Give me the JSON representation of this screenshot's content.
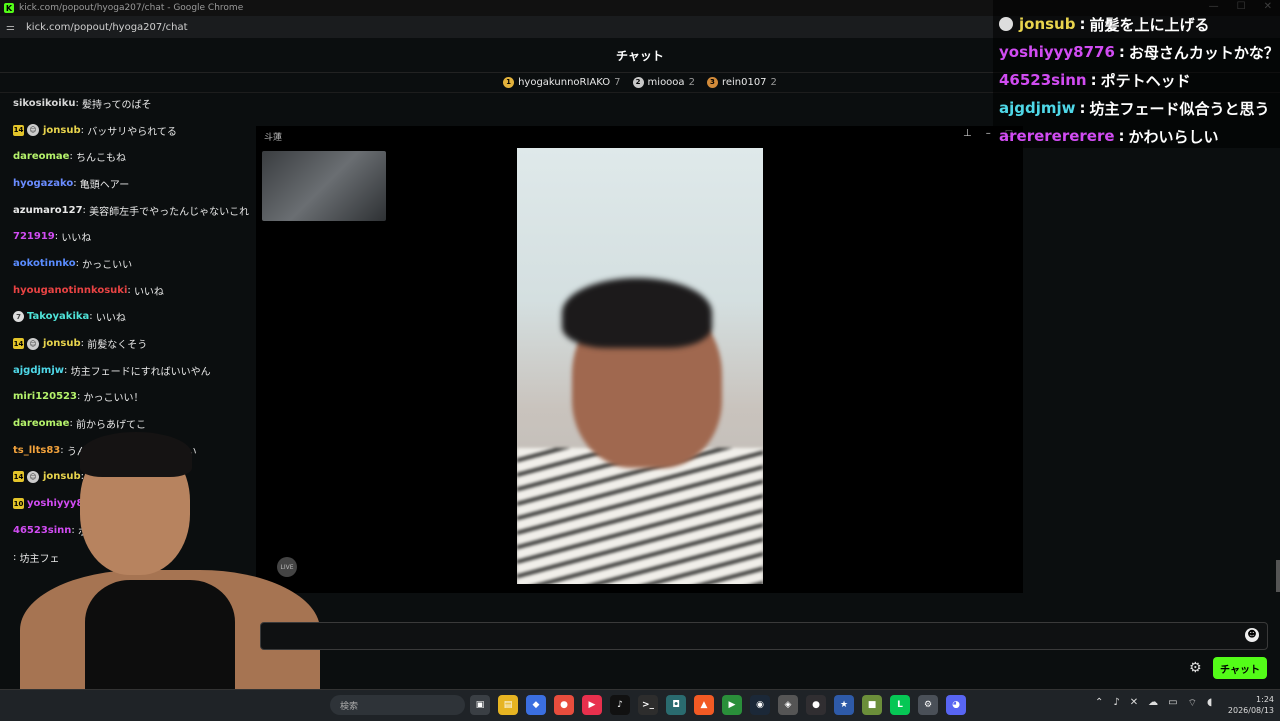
{
  "window": {
    "title": "kick.com/popout/hyoga207/chat - Google Chrome",
    "url": "kick.com/popout/hyoga207/chat"
  },
  "header": {
    "title": "チャット"
  },
  "leaderboard": [
    {
      "rank": "1",
      "name": "hyogakunnoRIAKO",
      "count": "7",
      "color": "#e3b23c"
    },
    {
      "rank": "2",
      "name": "mioooa",
      "count": "2",
      "color": "#c8c8c8"
    },
    {
      "rank": "3",
      "name": "rein0107",
      "count": "2",
      "color": "#d28b3a"
    }
  ],
  "messages": [
    {
      "user": "sikosikoiku",
      "text": "髪持ってのばそ",
      "color": "#d6d6d6",
      "badge": "",
      "avatar": false
    },
    {
      "user": "jonsub",
      "text": "バッサリやられてる",
      "color": "#e8d44d",
      "badge": "14",
      "avatar": true
    },
    {
      "user": "dareomae",
      "text": "ちんこもね",
      "color": "#b5f26b",
      "badge": "",
      "avatar": false
    },
    {
      "user": "hyogazako",
      "text": "亀頭ヘアー",
      "color": "#6a8cff",
      "badge": "",
      "avatar": false
    },
    {
      "user": "azumaro127",
      "text": "美容師左手でやったんじゃないこれ",
      "color": "#e8e8e8",
      "badge": "",
      "avatar": false
    },
    {
      "user": "721919",
      "text": "いいね",
      "color": "#d14cf2",
      "badge": "",
      "avatar": false
    },
    {
      "user": "aokotinnko",
      "text": "かっこいい",
      "color": "#5a8cff",
      "badge": "",
      "avatar": false
    },
    {
      "user": "hyouganotinnkosuki",
      "text": "いいね",
      "color": "#e84343",
      "badge": "",
      "avatar": false
    },
    {
      "user": "Takoyakika",
      "text": "いいね",
      "color": "#4fe3d8",
      "badge": "7",
      "avatar": false
    },
    {
      "user": "jonsub",
      "text": "前髪なくそう",
      "color": "#e8d44d",
      "badge": "14",
      "avatar": true
    },
    {
      "user": "ajgdjmjw",
      "text": "坊主フェードにすればいいやん",
      "color": "#4fd8e8",
      "badge": "",
      "avatar": false
    },
    {
      "user": "miri120523",
      "text": "かっこいい！",
      "color": "#b5f26b",
      "badge": "",
      "avatar": false
    },
    {
      "user": "dareomae",
      "text": "前からあげてこ",
      "color": "#b5f26b",
      "badge": "",
      "avatar": false
    },
    {
      "user": "ts_llts83",
      "text": "うん伸ばすより短い方がいい",
      "color": "#f2a23c",
      "badge": "",
      "avatar": false
    },
    {
      "user": "jonsub",
      "text": "",
      "color": "#e8d44d",
      "badge": "14",
      "avatar": true
    },
    {
      "user": "yoshiyyy8776",
      "text": "？",
      "color": "#d14cf2",
      "badge": "10",
      "avatar": false
    },
    {
      "user": "46523sinn",
      "text": "ポ",
      "color": "#d14cf2",
      "badge": "",
      "avatar": false
    },
    {
      "user": "",
      "text": "坊主フェ",
      "color": "#4fd8e8",
      "badge": "",
      "avatar": false
    }
  ],
  "video": {
    "window_title": "斗蓮",
    "live_label": "LIVE"
  },
  "overlay": [
    {
      "user": "jonsub",
      "text": "前髪を上に上げる",
      "color": "#e8d44d",
      "avatar": true
    },
    {
      "user": "yoshiyyy8776",
      "text": "お母さんカットかな？",
      "color": "#d14cf2",
      "avatar": false
    },
    {
      "user": "46523sinn",
      "text": "ポテトヘッド",
      "color": "#d14cf2",
      "avatar": false
    },
    {
      "user": "ajgdjmjw",
      "text": "坊主フェード似合うと思う",
      "color": "#4fd8e8",
      "avatar": false
    },
    {
      "user": "arererererere",
      "text": "かわいらしい",
      "color": "#d14cf2",
      "avatar": false
    }
  ],
  "input": {
    "placeholder": "",
    "send_label": "チャット"
  },
  "taskbar": {
    "search": "検索",
    "apps": [
      {
        "name": "task-view",
        "bg": "#3a3f44",
        "label": "▣"
      },
      {
        "name": "file-explorer",
        "bg": "#e6b422",
        "label": "▤"
      },
      {
        "name": "app-blue",
        "bg": "#3b6fe0",
        "label": "◆"
      },
      {
        "name": "chrome",
        "bg": "#e84d3d",
        "label": "●"
      },
      {
        "name": "app-red",
        "bg": "#e8304d",
        "label": "▶"
      },
      {
        "name": "tiktok",
        "bg": "#111111",
        "label": "♪"
      },
      {
        "name": "terminal",
        "bg": "#2d2d2d",
        "label": ">_"
      },
      {
        "name": "app-teal",
        "bg": "#2a6b6f",
        "label": "◘"
      },
      {
        "name": "brave",
        "bg": "#f25a24",
        "label": "▲"
      },
      {
        "name": "app-green",
        "bg": "#2a8f3a",
        "label": "▶"
      },
      {
        "name": "steam",
        "bg": "#1b2838",
        "label": "◉"
      },
      {
        "name": "app-gray",
        "bg": "#555555",
        "label": "◈"
      },
      {
        "name": "obs",
        "bg": "#302e31",
        "label": "●"
      },
      {
        "name": "app-star",
        "bg": "#2e5aa8",
        "label": "★"
      },
      {
        "name": "minecraft",
        "bg": "#6b8e3a",
        "label": "■"
      },
      {
        "name": "line",
        "bg": "#06c755",
        "label": "L"
      },
      {
        "name": "settings",
        "bg": "#4a5058",
        "label": "⚙"
      },
      {
        "name": "discord",
        "bg": "#5865f2",
        "label": "◕"
      }
    ],
    "time": "1:24",
    "date": "2026/08/13"
  }
}
